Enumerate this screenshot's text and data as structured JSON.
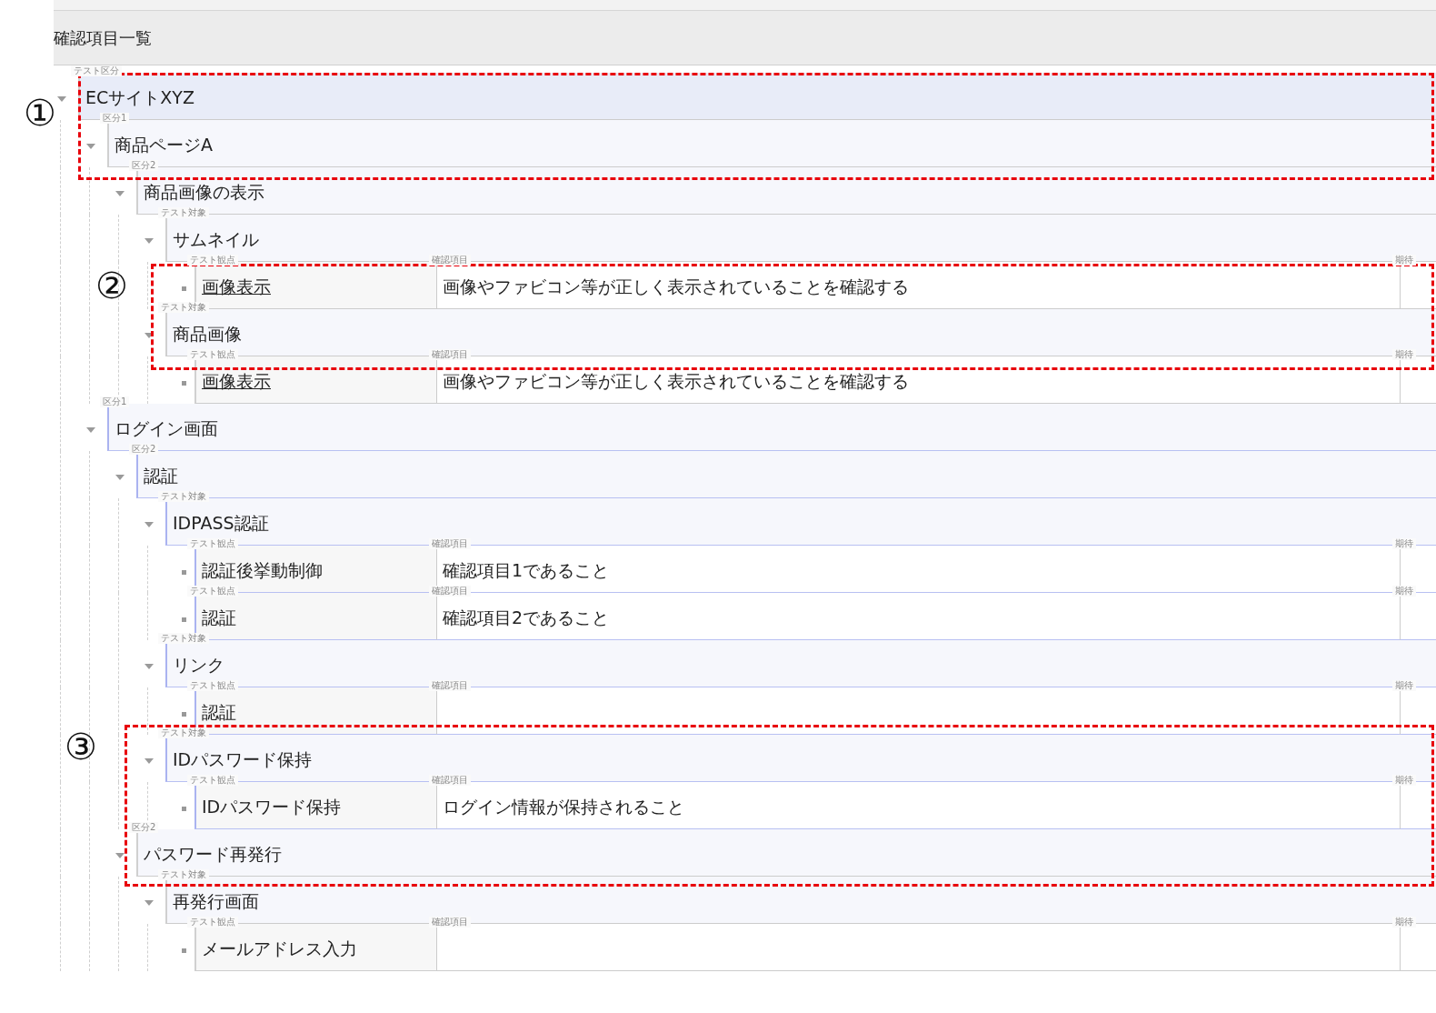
{
  "title": "確認項目一覧",
  "tree": [
    {
      "kind": "group",
      "label": "テスト区分",
      "text": "ECサイトXYZ",
      "expanded": true,
      "selected": true,
      "highlighted": false,
      "children": [
        {
          "kind": "group",
          "label": "区分1",
          "text": "商品ページA",
          "expanded": true,
          "selected": false,
          "highlighted": false,
          "children": [
            {
              "kind": "group",
              "label": "区分2",
              "text": "商品画像の表示",
              "expanded": true,
              "selected": false,
              "highlighted": false,
              "children": [
                {
                  "kind": "group",
                  "label": "テスト対象",
                  "text": "サムネイル",
                  "expanded": true,
                  "selected": false,
                  "highlighted": false,
                  "children": [
                    {
                      "kind": "leaf",
                      "label": "テスト観点",
                      "text": "画像表示",
                      "link": true,
                      "highlighted": false,
                      "check_label": "確認項目",
                      "check": "画像やファビコン等が正しく表示されていることを確認する",
                      "expected_label": "期待"
                    }
                  ]
                },
                {
                  "kind": "group",
                  "label": "テスト対象",
                  "text": "商品画像",
                  "expanded": true,
                  "selected": false,
                  "highlighted": false,
                  "children": [
                    {
                      "kind": "leaf",
                      "label": "テスト観点",
                      "text": "画像表示",
                      "link": true,
                      "highlighted": false,
                      "check_label": "確認項目",
                      "check": "画像やファビコン等が正しく表示されていることを確認する",
                      "expected_label": "期待"
                    }
                  ]
                }
              ]
            }
          ]
        },
        {
          "kind": "group",
          "label": "区分1",
          "text": "ログイン画面",
          "expanded": true,
          "selected": false,
          "highlighted": true,
          "children": [
            {
              "kind": "group",
              "label": "区分2",
              "text": "認証",
              "expanded": true,
              "selected": false,
              "highlighted": true,
              "children": [
                {
                  "kind": "group",
                  "label": "テスト対象",
                  "text": "IDPASS認証",
                  "expanded": true,
                  "selected": false,
                  "highlighted": true,
                  "children": [
                    {
                      "kind": "leaf",
                      "label": "テスト観点",
                      "text": "認証後挙動制御",
                      "link": false,
                      "highlighted": true,
                      "check_label": "確認項目",
                      "check": "確認項目1であること",
                      "expected_label": "期待"
                    },
                    {
                      "kind": "leaf",
                      "label": "テスト観点",
                      "text": "認証",
                      "link": false,
                      "highlighted": true,
                      "check_label": "確認項目",
                      "check": "確認項目2であること",
                      "expected_label": "期待"
                    }
                  ]
                },
                {
                  "kind": "group",
                  "label": "テスト対象",
                  "text": "リンク",
                  "expanded": true,
                  "selected": false,
                  "highlighted": true,
                  "children": [
                    {
                      "kind": "leaf",
                      "label": "テスト観点",
                      "text": "認証",
                      "link": false,
                      "highlighted": true,
                      "check_label": "確認項目",
                      "expected_label": "期待"
                    }
                  ]
                },
                {
                  "kind": "group",
                  "label": "テスト対象",
                  "text": "IDパスワード保持",
                  "expanded": true,
                  "selected": false,
                  "highlighted": true,
                  "children": [
                    {
                      "kind": "leaf",
                      "label": "テスト観点",
                      "text": "IDパスワード保持",
                      "link": false,
                      "highlighted": true,
                      "check_label": "確認項目",
                      "check": "ログイン情報が保持されること",
                      "expected_label": "期待"
                    }
                  ]
                }
              ]
            },
            {
              "kind": "group",
              "label": "区分2",
              "text": "パスワード再発行",
              "expanded": true,
              "selected": false,
              "highlighted": false,
              "children": [
                {
                  "kind": "group",
                  "label": "テスト対象",
                  "text": "再発行画面",
                  "expanded": true,
                  "selected": false,
                  "highlighted": false,
                  "children": [
                    {
                      "kind": "leaf",
                      "label": "テスト観点",
                      "text": "メールアドレス入力",
                      "link": false,
                      "highlighted": false,
                      "check_label": "確認項目",
                      "expected_label": "期待"
                    }
                  ]
                }
              ]
            }
          ]
        }
      ]
    }
  ],
  "annotations": [
    {
      "number": "①"
    },
    {
      "number": "②"
    },
    {
      "number": "③"
    }
  ]
}
